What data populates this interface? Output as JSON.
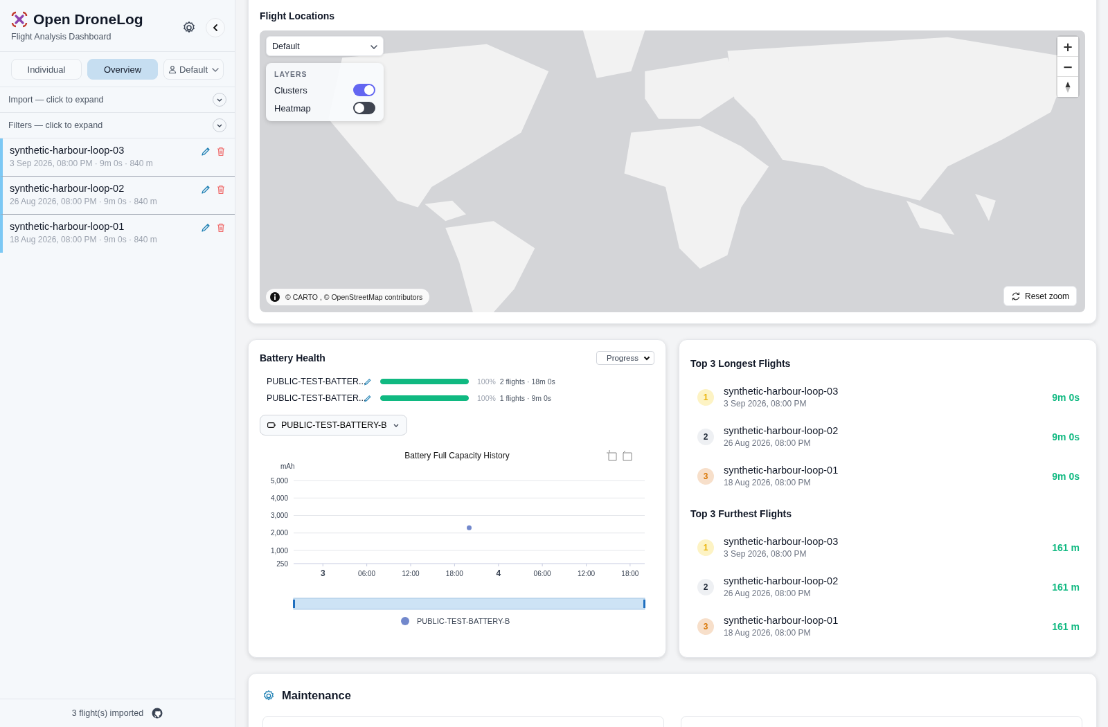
{
  "sidebar": {
    "app_title": "Open DroneLog",
    "subtitle": "Flight Analysis Dashboard",
    "tabs": [
      {
        "label": "Individual",
        "selected": false
      },
      {
        "label": "Overview",
        "selected": true
      }
    ],
    "profile": {
      "value": "Default"
    },
    "sections": [
      {
        "label": "Import — click to expand",
        "expanded": false
      },
      {
        "label": "Filters — click to expand",
        "expanded": false
      }
    ],
    "flights": [
      {
        "name": "synthetic-harbour-loop-03",
        "meta": "3 Sep 2026, 08:00 PM · 9m 0s · 840 m",
        "selected": true
      },
      {
        "name": "synthetic-harbour-loop-02",
        "meta": "26 Aug 2026, 08:00 PM · 9m 0s · 840 m",
        "selected": true
      },
      {
        "name": "synthetic-harbour-loop-01",
        "meta": "18 Aug 2026, 08:00 PM · 9m 0s · 840 m",
        "selected": true
      }
    ],
    "footer": "3 flight(s) imported"
  },
  "map_card": {
    "title": "Flight Locations",
    "style_select": {
      "value": "Default"
    },
    "layers_heading": "LAYERS",
    "layers": [
      {
        "label": "Clusters",
        "on": true
      },
      {
        "label": "Heatmap",
        "on": false
      }
    ],
    "attribution": "© CARTO , © OpenStreetMap contributors",
    "reset_button": "Reset zoom",
    "zoom_in": "+",
    "zoom_out": "−"
  },
  "battery_card": {
    "title": "Battery Health",
    "view_select": {
      "value": "Progress"
    },
    "batteries": [
      {
        "name": "PUBLIC-TEST-BATTER...",
        "level": 1.0,
        "percent": "100%",
        "stats": "2 flights · 18m 0s"
      },
      {
        "name": "PUBLIC-TEST-BATTER...",
        "level": 1.0,
        "percent": "100%",
        "stats": "1 flights · 9m 0s"
      }
    ],
    "battery_select": {
      "value": "PUBLIC-TEST-BATTERY-B"
    },
    "chart_data": {
      "type": "scatter",
      "title": "Battery Full Capacity History",
      "ylabel": "mAh",
      "xlim": [
        "2026-09-02T20:00",
        "2026-09-04T20:00"
      ],
      "ylim": [
        250,
        5000
      ],
      "grid": true,
      "xticks": [
        {
          "value": "2026-09-03T00:00",
          "label": "3"
        },
        {
          "value": "2026-09-03T06:00",
          "label": "06:00"
        },
        {
          "value": "2026-09-03T12:00",
          "label": "12:00"
        },
        {
          "value": "2026-09-03T18:00",
          "label": "18:00"
        },
        {
          "value": "2026-09-04T00:00",
          "label": "4"
        },
        {
          "value": "2026-09-04T06:00",
          "label": "06:00"
        },
        {
          "value": "2026-09-04T12:00",
          "label": "12:00"
        },
        {
          "value": "2026-09-04T18:00",
          "label": "18:00"
        }
      ],
      "yticks": [
        {
          "value": 250,
          "label": "250"
        },
        {
          "value": 1000,
          "label": "1,000"
        },
        {
          "value": 2000,
          "label": "2,000"
        },
        {
          "value": 3000,
          "label": "3,000"
        },
        {
          "value": 4000,
          "label": "4,000"
        },
        {
          "value": 5000,
          "label": "5,000"
        }
      ],
      "series": [
        {
          "name": "PUBLIC-TEST-BATTERY-B",
          "color": "#7288cc",
          "x": [
            "2026-09-03T20:00"
          ],
          "values": [
            2300
          ]
        }
      ]
    }
  },
  "top_card": {
    "sections": [
      {
        "title": "Top 3 Longest Flights",
        "items": [
          {
            "rank": "1",
            "name": "synthetic-harbour-loop-03",
            "date": "3 Sep 2026, 08:00 PM",
            "value": "9m 0s"
          },
          {
            "rank": "2",
            "name": "synthetic-harbour-loop-02",
            "date": "26 Aug 2026, 08:00 PM",
            "value": "9m 0s"
          },
          {
            "rank": "3",
            "name": "synthetic-harbour-loop-01",
            "date": "18 Aug 2026, 08:00 PM",
            "value": "9m 0s"
          }
        ]
      },
      {
        "title": "Top 3 Furthest Flights",
        "items": [
          {
            "rank": "1",
            "name": "synthetic-harbour-loop-03",
            "date": "3 Sep 2026, 08:00 PM",
            "value": "161 m"
          },
          {
            "rank": "2",
            "name": "synthetic-harbour-loop-02",
            "date": "26 Aug 2026, 08:00 PM",
            "value": "161 m"
          },
          {
            "rank": "3",
            "name": "synthetic-harbour-loop-01",
            "date": "18 Aug 2026, 08:00 PM",
            "value": "161 m"
          }
        ]
      }
    ]
  },
  "maintenance_card": {
    "title": "Maintenance"
  }
}
